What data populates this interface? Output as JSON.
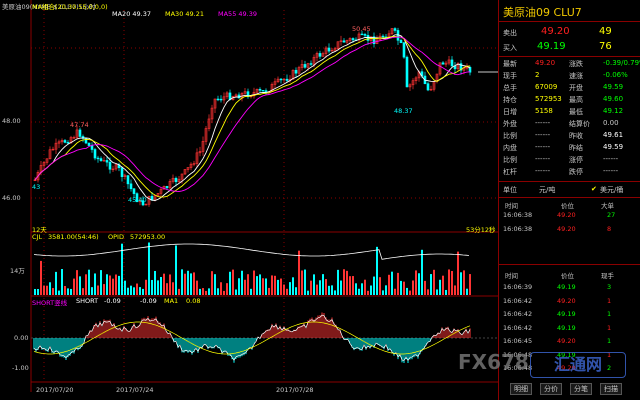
{
  "colors": {
    "up": "#ff3333",
    "down": "#00ffff",
    "ma20": "#ffffff",
    "ma30": "#ffff00",
    "ma55": "#ff00ff",
    "grid": "#8a0000",
    "title": "#f0c800",
    "green": "#00ff00",
    "red": "#ff2020"
  },
  "chart_header": {
    "symbol_label": "美原油09(NYME-$ CLU7)1小时",
    "ma_group": "MA组合(20,30,55,0,0,0)",
    "ma20": "MA20 49.37",
    "ma30": "MA30 49.21",
    "ma55": "MA55 49.39"
  },
  "price_axis": {
    "ticks": [
      "48.00",
      "46.00"
    ]
  },
  "price_annotations": {
    "high": "50.45",
    "peak_left": "47.74",
    "low_left": "45.40",
    "low_right": "48.37",
    "left_edge": "43"
  },
  "period_marker": "12天",
  "time_readout": "53分12秒",
  "volume": {
    "title": "CJL",
    "cjl_value": "3581.00(54:46)",
    "opid_label": "OPID",
    "opid_value": "572953.00",
    "axis_label": "14万"
  },
  "short_indicator": {
    "title": "SHORT竖线",
    "short_label": "SHORT",
    "short_value": "-0.09",
    "value2": "-0.09",
    "ma1_label": "MA1",
    "ma1_value": "0.08",
    "ticks": [
      "0.00",
      "-1.00"
    ]
  },
  "dates": [
    "2017/07/20",
    "2017/07/24",
    "2017/07/28"
  ],
  "quote": {
    "title": "美原油09 CLU7",
    "sell_label": "卖出",
    "sell_price": "49.20",
    "sell_vol": "49",
    "buy_label": "买入",
    "buy_price": "49.19",
    "buy_vol": "76",
    "rows": [
      {
        "l1": "最新",
        "v1": "49.20",
        "l2": "涨跌",
        "v2": "-0.39/0.79%"
      },
      {
        "l1": "现手",
        "v1": "2",
        "l2": "速涨",
        "v2": "-0.06%"
      },
      {
        "l1": "总手",
        "v1": "67009",
        "l2": "开盘",
        "v2": "49.59"
      },
      {
        "l1": "持仓",
        "v1": "572953",
        "l2": "最高",
        "v2": "49.60"
      },
      {
        "l1": "日增",
        "v1": "5158",
        "l2": "最低",
        "v2": "49.12"
      },
      {
        "l1": "外盘",
        "v1": "------",
        "l2": "结算价",
        "v2": "0.00"
      },
      {
        "l1": "比例",
        "v1": "------",
        "l2": "昨收",
        "v2": "49.61"
      },
      {
        "l1": "内盘",
        "v1": "------",
        "l2": "昨结",
        "v2": "49.59"
      },
      {
        "l1": "比例",
        "v1": "------",
        "l2": "涨停",
        "v2": "------"
      },
      {
        "l1": "杠杆",
        "v1": "------",
        "l2": "跌停",
        "v2": "------"
      }
    ],
    "unit_label": "单位",
    "unit_value": "元/吨",
    "unit_alt": "美元/桶",
    "bigorder_headers": [
      "时间",
      "价位",
      "大单"
    ],
    "bigorders": [
      {
        "time": "16:06:38",
        "price": "49.20",
        "vol": "27"
      },
      {
        "time": "16:06:38",
        "price": "49.20",
        "vol": "8"
      }
    ],
    "tick_headers": [
      "时间",
      "价位",
      "现手"
    ],
    "ticks": [
      {
        "time": "16:06:39",
        "price": "49.19",
        "vol": "3"
      },
      {
        "time": "16:06:42",
        "price": "49.20",
        "vol": "1"
      },
      {
        "time": "16:06:42",
        "price": "49.19",
        "vol": "1"
      },
      {
        "time": "16:06:42",
        "price": "49.19",
        "vol": "1"
      },
      {
        "time": "16:06:45",
        "price": "49.20",
        "vol": "1"
      },
      {
        "time": "16:06:48",
        "price": "49.19",
        "vol": "1"
      },
      {
        "time": "16:06:48",
        "price": "49.20",
        "vol": "2"
      }
    ],
    "tabs": [
      "明细",
      "分价",
      "分笔",
      "扫描"
    ]
  },
  "watermark": {
    "brand": "FX678",
    "cn": "汇通网"
  }
}
